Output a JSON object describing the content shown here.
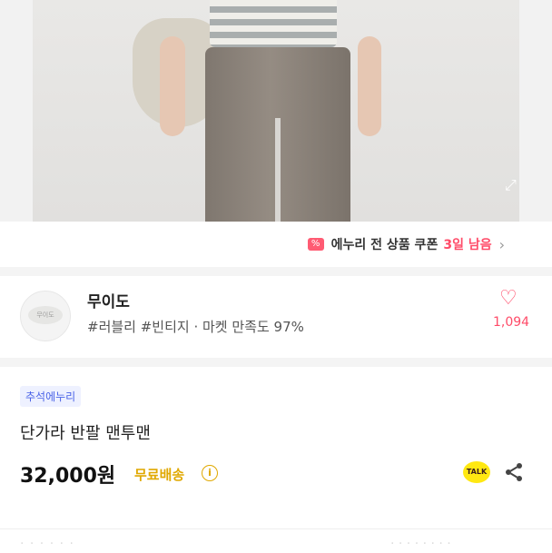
{
  "coupon": {
    "icon": "coupon-icon",
    "text": "에누리 전 상품 쿠폰",
    "remaining": "3일 남음"
  },
  "store": {
    "avatar_text": "무이도",
    "name": "무이도",
    "tags": "#러블리 #빈티지 · 마켓 만족도 97%",
    "likes": "1,094"
  },
  "product": {
    "badge": "추석에누리",
    "title": "단가라 반팔 맨투맨",
    "price": "32,000원",
    "shipping": "무료배송"
  },
  "actions": {
    "kakao_label": "TALK"
  },
  "colors": {
    "accent_pink": "#ff4b68",
    "badge_blue": "#4a63e7",
    "shipping_yellow": "#e0a800"
  }
}
